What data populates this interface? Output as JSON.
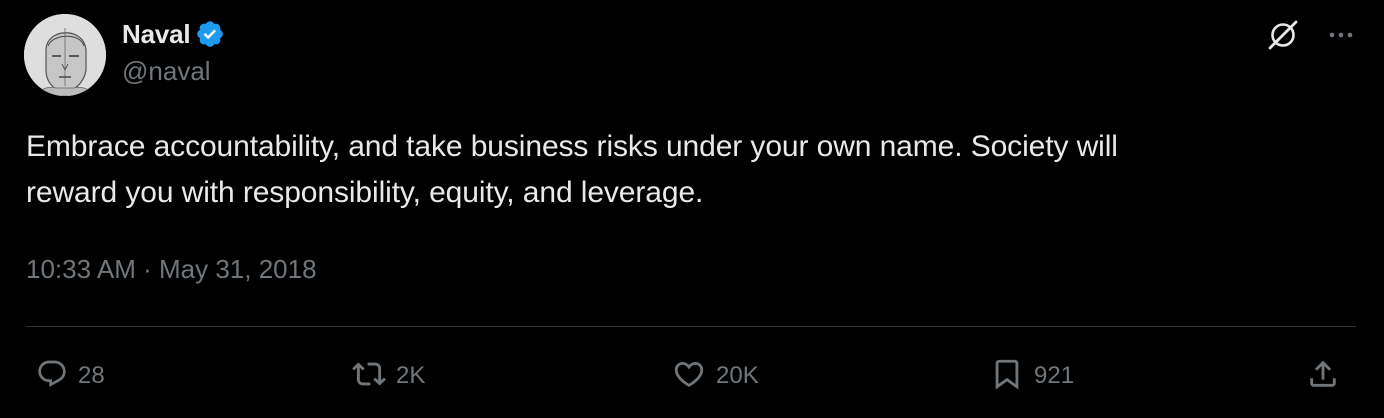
{
  "author": {
    "display_name": "Naval",
    "handle": "@naval",
    "verified": true
  },
  "tweet": {
    "text": "Embrace accountability, and take business risks under your own name. Society will\nreward you with responsibility, equity, and leverage.",
    "time": "10:33 AM",
    "separator": "·",
    "date": "May 31, 2018"
  },
  "actions": {
    "replies": "28",
    "reposts": "2K",
    "likes": "20K",
    "bookmarks": "921"
  },
  "colors": {
    "background": "#000000",
    "primary_text": "#e7e9ea",
    "secondary_text": "#71767b",
    "verified_badge": "#1d9bf0",
    "divider": "#2f3336"
  },
  "icons": {
    "top_right": [
      "grok-icon",
      "more-icon"
    ],
    "action_bar": [
      "reply-icon",
      "repost-icon",
      "like-icon",
      "bookmark-icon",
      "share-icon"
    ]
  }
}
